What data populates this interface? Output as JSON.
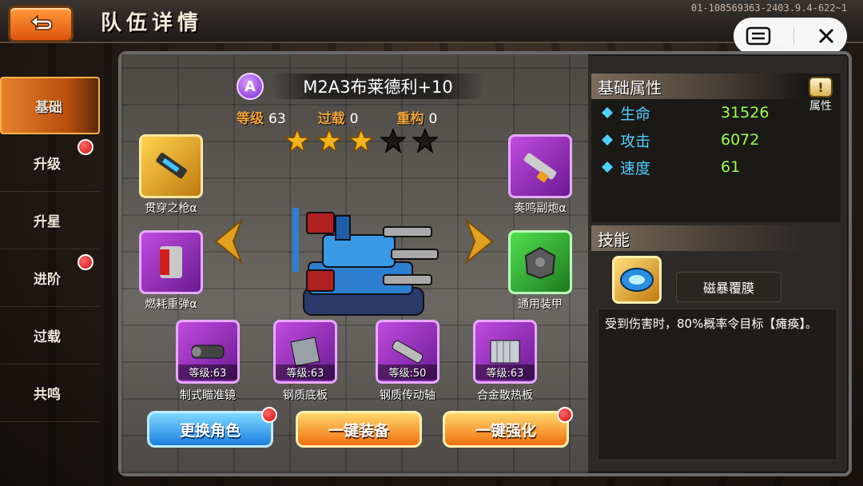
{
  "header": {
    "title": "队伍详情",
    "version": "01-108569363-2403.9.4-622~1"
  },
  "sidebar": {
    "items": [
      {
        "label": "基础",
        "active": true,
        "dot": false
      },
      {
        "label": "升级",
        "active": false,
        "dot": true
      },
      {
        "label": "升星",
        "active": false,
        "dot": false
      },
      {
        "label": "进阶",
        "active": false,
        "dot": true
      },
      {
        "label": "过载",
        "active": false,
        "dot": false
      },
      {
        "label": "共鸣",
        "active": false,
        "dot": false
      }
    ]
  },
  "hero": {
    "rank": "A",
    "name": "M2A3布莱德利+10",
    "level_label": "等级",
    "level": "63",
    "overload_label": "过载",
    "overload": "0",
    "rebuild_label": "重构",
    "rebuild": "0",
    "stars_filled": 3,
    "stars_total": 5
  },
  "weapons": {
    "top_left": "贯穿之枪α",
    "top_right": "奏鸣副炮α",
    "mid_left": "燃耗重弹α",
    "mid_right": "通用装甲"
  },
  "parts": [
    {
      "name": "制式瞄准镜",
      "level": "等级:63"
    },
    {
      "name": "钢质底板",
      "level": "等级:63"
    },
    {
      "name": "钢质传动轴",
      "level": "等级:50"
    },
    {
      "name": "合金散热板",
      "level": "等级:63"
    }
  ],
  "buttons": {
    "change_role": "更换角色",
    "one_key_equip": "一键装备",
    "one_key_strengthen": "一键强化"
  },
  "attributes": {
    "title": "基础属性",
    "detail_button": "属性",
    "rows": [
      {
        "name": "生命",
        "value": "31526"
      },
      {
        "name": "攻击",
        "value": "6072"
      },
      {
        "name": "速度",
        "value": "61"
      }
    ]
  },
  "skill": {
    "title": "技能",
    "name": "磁暴覆膜",
    "description": "受到伤害时，80%概率令目标【瘫痪】。"
  },
  "colors": {
    "accent_orange": "#f07010",
    "attr_name": "#4fd0ff",
    "attr_value": "#9cff4a",
    "stat_label": "#f0a43a"
  }
}
